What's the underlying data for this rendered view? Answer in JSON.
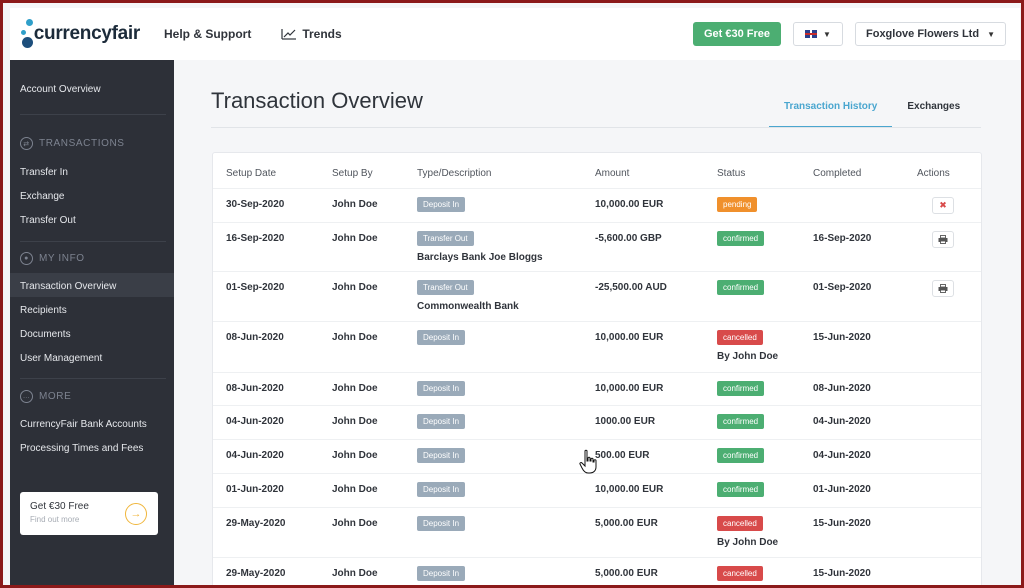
{
  "brand": {
    "logo_text": "currencyfair"
  },
  "topnav": {
    "help": "Help & Support",
    "trends": "Trends",
    "cta": "Get €30 Free",
    "company": "Foxglove Flowers Ltd"
  },
  "icons": {
    "trend": "trend-chart-icon",
    "flag": "uk-flag-icon",
    "cancel": "close-x-icon",
    "print": "printer-icon"
  },
  "colors": {
    "accent": "#4aa6cf",
    "green": "#4cae72",
    "pending": "#f0902c",
    "cancelled": "#d84a4a",
    "sidebar": "#2d3038"
  },
  "sidebar": {
    "account_overview": "Account Overview",
    "sec_transactions": "TRANSACTIONS",
    "transfer_in": "Transfer In",
    "exchange": "Exchange",
    "transfer_out": "Transfer Out",
    "sec_myinfo": "MY INFO",
    "transaction_overview": "Transaction Overview",
    "recipients": "Recipients",
    "documents": "Documents",
    "user_management": "User Management",
    "sec_more": "MORE",
    "bank_accounts": "CurrencyFair Bank Accounts",
    "processing": "Processing Times and Fees",
    "promo_title": "Get €30 Free",
    "promo_sub": "Find out more"
  },
  "main": {
    "title": "Transaction Overview",
    "tab_history": "Transaction History",
    "tab_exchanges": "Exchanges"
  },
  "table": {
    "headers": [
      "Setup Date",
      "Setup By",
      "Type/Description",
      "Amount",
      "Status",
      "Completed",
      "Actions"
    ],
    "rows": [
      {
        "date": "30-Sep-2020",
        "by": "John Doe",
        "type": "Deposit In",
        "desc": "",
        "amount": "10,000.00 EUR",
        "status": "pending",
        "status_note": "",
        "completed": "",
        "action": "cancel"
      },
      {
        "date": "16-Sep-2020",
        "by": "John Doe",
        "type": "Transfer Out",
        "desc": "Barclays Bank Joe Bloggs",
        "amount": "-5,600.00 GBP",
        "status": "confirmed",
        "status_note": "",
        "completed": "16-Sep-2020",
        "action": "print"
      },
      {
        "date": "01-Sep-2020",
        "by": "John Doe",
        "type": "Transfer Out",
        "desc": "Commonwealth Bank",
        "amount": "-25,500.00 AUD",
        "status": "confirmed",
        "status_note": "",
        "completed": "01-Sep-2020",
        "action": "print"
      },
      {
        "date": "08-Jun-2020",
        "by": "John Doe",
        "type": "Deposit In",
        "desc": "",
        "amount": "10,000.00 EUR",
        "status": "cancelled",
        "status_note": "By John Doe",
        "completed": "15-Jun-2020",
        "action": ""
      },
      {
        "date": "08-Jun-2020",
        "by": "John Doe",
        "type": "Deposit In",
        "desc": "",
        "amount": "10,000.00 EUR",
        "status": "confirmed",
        "status_note": "",
        "completed": "08-Jun-2020",
        "action": ""
      },
      {
        "date": "04-Jun-2020",
        "by": "John Doe",
        "type": "Deposit In",
        "desc": "",
        "amount": "1000.00 EUR",
        "status": "confirmed",
        "status_note": "",
        "completed": "04-Jun-2020",
        "action": ""
      },
      {
        "date": "04-Jun-2020",
        "by": "John Doe",
        "type": "Deposit In",
        "desc": "",
        "amount": "500.00 EUR",
        "status": "confirmed",
        "status_note": "",
        "completed": "04-Jun-2020",
        "action": ""
      },
      {
        "date": "01-Jun-2020",
        "by": "John Doe",
        "type": "Deposit In",
        "desc": "",
        "amount": "10,000.00 EUR",
        "status": "confirmed",
        "status_note": "",
        "completed": "01-Jun-2020",
        "action": ""
      },
      {
        "date": "29-May-2020",
        "by": "John Doe",
        "type": "Deposit In",
        "desc": "",
        "amount": "5,000.00 EUR",
        "status": "cancelled",
        "status_note": "By John Doe",
        "completed": "15-Jun-2020",
        "action": ""
      },
      {
        "date": "29-May-2020",
        "by": "John Doe",
        "type": "Deposit In",
        "desc": "",
        "amount": "5,000.00 EUR",
        "status": "cancelled",
        "status_note": "",
        "completed": "15-Jun-2020",
        "action": ""
      }
    ]
  }
}
